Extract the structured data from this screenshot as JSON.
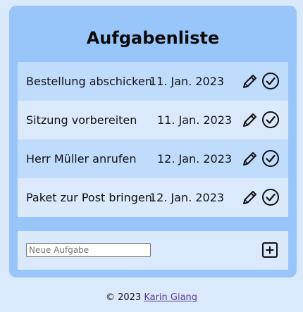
{
  "app": {
    "title": "Aufgabenliste"
  },
  "tasks": [
    {
      "name": "Bestellung abschicken",
      "date": "11. Jan. 2023"
    },
    {
      "name": "Sitzung vorbereiten",
      "date": "11. Jan. 2023"
    },
    {
      "name": "Herr Müller anrufen",
      "date": "12. Jan. 2023"
    },
    {
      "name": "Paket zur Post bringen",
      "date": "12. Jan. 2023"
    }
  ],
  "icons": {
    "edit": "pencil-icon",
    "done": "check-circle-icon",
    "add": "plus-square-icon"
  },
  "new_task": {
    "placeholder": "Neue Aufgabe",
    "value": ""
  },
  "footer": {
    "copyright": "© 2023",
    "author": "Karin Giang"
  },
  "colors": {
    "background": "#dbe9fd",
    "card": "#98c6fb",
    "row_alt": "#c0dcfc",
    "link": "#5b3a8c"
  }
}
